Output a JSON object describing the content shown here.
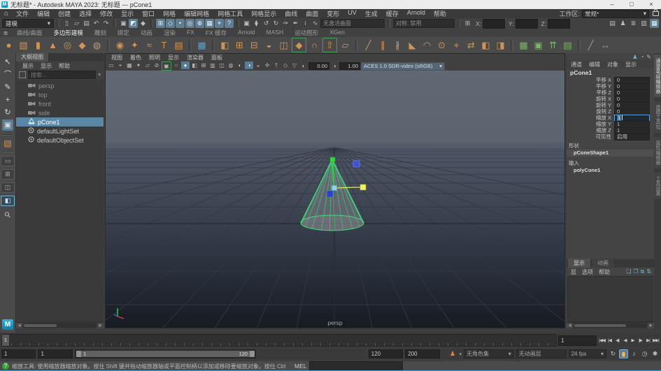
{
  "titlebar": {
    "title": "无标题* - Autodesk MAYA 2023: 无标题 --- pCone1",
    "app_badge": "M",
    "minimize": "–",
    "maximize": "□",
    "close": "×"
  },
  "menubar": {
    "home_icon": "⌂",
    "items": [
      "文件",
      "编辑",
      "创建",
      "选择",
      "修改",
      "显示",
      "窗口",
      "网格",
      "编辑网格",
      "网格工具",
      "网格显示",
      "曲线",
      "曲面",
      "变形",
      "UV",
      "生成",
      "缓存",
      "Arnold",
      "帮助"
    ],
    "workspace_label": "工作区:",
    "workspace_value": "常规*",
    "dropdown_arrow": "▾"
  },
  "statusline": {
    "mode": "建模",
    "dropdown_arrow": "▾",
    "file_icons": [
      {
        "name": "new-scene-icon",
        "glyph": "▯"
      },
      {
        "name": "open-scene-icon",
        "glyph": "▱"
      },
      {
        "name": "save-scene-icon",
        "glyph": "▤"
      },
      {
        "name": "undo-icon",
        "glyph": "↶"
      },
      {
        "name": "redo-icon",
        "glyph": "↷"
      }
    ],
    "selection_icons": [
      {
        "name": "select-hierarchy-icon",
        "glyph": "▣"
      },
      {
        "name": "select-object-icon",
        "glyph": "◩",
        "active": true
      },
      {
        "name": "select-component-icon",
        "glyph": "◆"
      }
    ],
    "snap_icons": [
      {
        "name": "snap-grid-icon",
        "glyph": "⊞"
      },
      {
        "name": "snap-curve-icon",
        "glyph": "◇"
      },
      {
        "name": "snap-point-icon",
        "glyph": "•"
      },
      {
        "name": "snap-projected-center-icon",
        "glyph": "◎"
      },
      {
        "name": "snap-view-plane-icon",
        "glyph": "⊕"
      },
      {
        "name": "make-live-icon",
        "glyph": "▦"
      },
      {
        "name": "snap-together-icon",
        "glyph": "⌖"
      },
      {
        "name": "snap-help-icon",
        "glyph": "?"
      }
    ],
    "history_icons": [
      {
        "name": "lock-selection-icon",
        "glyph": "▣"
      },
      {
        "name": "highlight-selection-icon",
        "glyph": "⧫"
      },
      {
        "name": "construction-history-icon",
        "glyph": "↺"
      },
      {
        "name": "rigid-body-icon",
        "glyph": "↻"
      },
      {
        "name": "soft-mod-icon",
        "glyph": "✑"
      },
      {
        "name": "cluster-icon",
        "glyph": "✒"
      },
      {
        "name": "curve-snap-icon",
        "glyph": "≀"
      },
      {
        "name": "wire-icon",
        "glyph": "∿"
      }
    ],
    "no_active_surface": "无激活曲面",
    "symmetry": "对称: 禁用",
    "grid_icon": "⊞",
    "axis_labels": [
      "X:",
      "Y:",
      "Z:"
    ],
    "editor_icons": [
      {
        "name": "modeling-toolkit-toggle-icon",
        "glyph": "▤"
      },
      {
        "name": "character-controls-icon",
        "glyph": "♟"
      },
      {
        "name": "attribute-editor-toggle-icon",
        "glyph": "≣"
      },
      {
        "name": "tool-settings-toggle-icon",
        "glyph": "▥"
      },
      {
        "name": "channel-box-toggle-icon",
        "glyph": "▦",
        "active": true
      }
    ]
  },
  "shelf": {
    "menu_icon": "≣",
    "tabs": [
      {
        "label": "曲线/曲面"
      },
      {
        "label": "多边形建模",
        "active": true
      },
      {
        "label": "雕刻"
      },
      {
        "label": "绑定"
      },
      {
        "label": "动画"
      },
      {
        "label": "渲染"
      },
      {
        "label": "FX"
      },
      {
        "label": "FX 缓存"
      },
      {
        "label": "Arnold"
      },
      {
        "label": "MASH"
      },
      {
        "label": "运动图形"
      },
      {
        "label": "XGen"
      }
    ],
    "icons": [
      {
        "name": "poly-sphere-icon",
        "glyph": "●",
        "color": "#d29455"
      },
      {
        "name": "poly-cube-icon",
        "glyph": "▧",
        "color": "#d29455"
      },
      {
        "name": "poly-cylinder-icon",
        "glyph": "▮",
        "color": "#d29455"
      },
      {
        "name": "poly-cone-icon",
        "glyph": "▲",
        "color": "#d29455"
      },
      {
        "name": "poly-torus-icon",
        "glyph": "◎",
        "color": "#d29455"
      },
      {
        "name": "poly-plane-icon",
        "glyph": "◆",
        "color": "#d29455"
      },
      {
        "name": "poly-disc-icon",
        "glyph": "◍",
        "color": "#d29455"
      },
      {
        "divider": true
      },
      {
        "name": "super-shape-icon",
        "glyph": "◉",
        "color": "#d29455"
      },
      {
        "name": "sweep-mesh-icon",
        "glyph": "✦",
        "color": "#d29455"
      },
      {
        "name": "curve-warp-icon",
        "glyph": "≈",
        "color": "#d29455"
      },
      {
        "name": "type-tool-icon",
        "glyph": "T",
        "color": "#d29455"
      },
      {
        "name": "svg-tool-icon",
        "glyph": "▤",
        "color": "#d29455"
      },
      {
        "divider": true
      },
      {
        "name": "modeling-toolkit-icon",
        "glyph": "▦",
        "color": "#5f9ec7"
      },
      {
        "divider": true
      },
      {
        "name": "result-mesh-icon",
        "glyph": "◧",
        "color": "#d29455"
      },
      {
        "name": "combine-icon",
        "glyph": "⊞",
        "color": "#d29455"
      },
      {
        "name": "separate-icon",
        "glyph": "⊟",
        "color": "#d29455"
      },
      {
        "name": "smooth-icon",
        "glyph": "◒",
        "color": "#d29455"
      },
      {
        "name": "subdivide-icon",
        "glyph": "◫",
        "color": "#d29455"
      },
      {
        "name": "bevel-icon",
        "glyph": "◆",
        "color": "#d29455",
        "border": "#3f9e4f"
      },
      {
        "name": "bridge-icon",
        "glyph": "∩",
        "color": "#d29455"
      },
      {
        "name": "extrude-icon",
        "glyph": "⇧",
        "color": "#d29455",
        "border": "#3f9e4f"
      },
      {
        "name": "quad-draw-icon",
        "glyph": "▱",
        "color": "#d29455"
      },
      {
        "divider": true
      },
      {
        "name": "multi-cut-icon",
        "glyph": "╱",
        "color": "#d29455"
      },
      {
        "name": "insert-edge-loop-icon",
        "glyph": "∥",
        "color": "#d29455"
      },
      {
        "name": "offset-edge-loop-icon",
        "glyph": "∦",
        "color": "#d29455"
      },
      {
        "name": "append-polygon-icon",
        "glyph": "◣",
        "color": "#d29455"
      },
      {
        "name": "sculpt-icon",
        "glyph": "◠",
        "color": "#d29455"
      },
      {
        "name": "merge-icon",
        "glyph": "⊙",
        "color": "#d29455"
      },
      {
        "name": "target-weld-icon",
        "glyph": "⌖",
        "color": "#d29455"
      },
      {
        "name": "flip-icon",
        "glyph": "⇄",
        "color": "#d29455"
      },
      {
        "name": "symmetry-icon",
        "glyph": "◧",
        "color": "#d29455"
      },
      {
        "name": "mirror-icon",
        "glyph": "◨",
        "color": "#d29455"
      },
      {
        "divider": true
      },
      {
        "name": "crease-set-icon",
        "glyph": "▦",
        "color": "#7cb46b"
      },
      {
        "name": "uv-editor-icon",
        "glyph": "▣",
        "color": "#7cb46b"
      },
      {
        "name": "normals-icon",
        "glyph": "⇈",
        "color": "#7cb46b"
      },
      {
        "name": "color-set-icon",
        "glyph": "▤",
        "color": "#7cb46b"
      },
      {
        "divider": true
      },
      {
        "name": "knife-icon",
        "glyph": "╱",
        "color": "#9a9a9a"
      },
      {
        "name": "measure-icon",
        "glyph": "↔",
        "color": "#9a9a9a"
      }
    ]
  },
  "toolbox": {
    "tools": [
      {
        "name": "select-tool",
        "glyph": "↖"
      },
      {
        "name": "lasso-tool",
        "glyph": "⌒"
      },
      {
        "name": "paint-select-tool",
        "glyph": "✎"
      },
      {
        "name": "move-tool",
        "glyph": "+"
      },
      {
        "name": "rotate-tool",
        "glyph": "↻"
      },
      {
        "name": "scale-tool",
        "glyph": "▣",
        "active": true
      }
    ],
    "symmetry_cube_glyph": "▧",
    "layouts": [
      {
        "name": "layout-single-pane",
        "glyph": "▭"
      },
      {
        "name": "layout-four-pane",
        "glyph": "⊞"
      },
      {
        "name": "layout-two-pane",
        "glyph": "◫"
      },
      {
        "name": "layout-outliner-persp",
        "glyph": "◧",
        "active": true
      }
    ],
    "magnifier_glyph": "⚲",
    "maya_logo": "M"
  },
  "outliner": {
    "title": "大纲视图",
    "menus": [
      "展示",
      "显示",
      "帮助"
    ],
    "search_placeholder": "搜索...",
    "dropdown_arrow": "▾",
    "items": [
      {
        "name": "outliner-item-persp",
        "label": "persp",
        "icon": "camera",
        "muted": true
      },
      {
        "name": "outliner-item-top",
        "label": "top",
        "icon": "camera",
        "muted": true
      },
      {
        "name": "outliner-item-front",
        "label": "front",
        "icon": "camera",
        "muted": true
      },
      {
        "name": "outliner-item-side",
        "label": "side",
        "icon": "camera",
        "muted": true
      },
      {
        "name": "outliner-item-pcone1",
        "label": "pCone1",
        "icon": "cone",
        "selected": true
      },
      {
        "name": "outliner-item-defaultlightset",
        "label": "defaultLightSet",
        "icon": "set"
      },
      {
        "name": "outliner-item-defaultobjectset",
        "label": "defaultObjectSet",
        "icon": "set"
      }
    ]
  },
  "viewport": {
    "menus": [
      "视图",
      "着色",
      "照明",
      "显示",
      "渲染器",
      "面板"
    ],
    "toolbar_icons": [
      {
        "name": "select-camera-icon",
        "glyph": "▭"
      },
      {
        "name": "lock-camera-icon",
        "glyph": "⌖"
      },
      {
        "name": "camera-attributes-icon",
        "glyph": "▦"
      },
      {
        "name": "bookmark-icon",
        "glyph": "✦"
      },
      {
        "name": "image-plane-icon",
        "glyph": "▱"
      },
      {
        "name": "2d-pan-zoom-icon",
        "glyph": "⊘"
      },
      {
        "name": "isolate-select-icon",
        "glyph": "▣",
        "border": "#3f9e4f"
      },
      {
        "name": "wireframe-icon",
        "glyph": "○"
      },
      {
        "name": "shaded-icon",
        "glyph": "●",
        "active": true
      },
      {
        "name": "textured-icon",
        "glyph": "◧"
      },
      {
        "name": "use-all-lights-icon",
        "glyph": "⊞"
      },
      {
        "name": "shadows-icon",
        "glyph": "▥"
      },
      {
        "name": "screen-space-ao-icon",
        "glyph": "◫"
      },
      {
        "name": "motion-blur-icon",
        "glyph": "◍"
      },
      {
        "name": "multisample-icon",
        "glyph": "◐"
      },
      {
        "name": "depth-of-field-icon",
        "glyph": "◑",
        "active": true
      },
      {
        "name": "xray-icon",
        "glyph": "◒"
      },
      {
        "name": "xray-joints-icon",
        "glyph": "✛"
      },
      {
        "name": "plugin-shapes-icon",
        "glyph": "†"
      },
      {
        "name": "grease-pencil-icon",
        "glyph": "◇"
      },
      {
        "name": "grid-toggle-icon",
        "glyph": "▽"
      }
    ],
    "exposure_icon": "◐",
    "exposure": "0.00",
    "gamma_icon": "◑",
    "gamma": "1.00",
    "colorspace": "ACES 1.0 SDR-video (sRGB)",
    "dropdown_arrow": "▾",
    "camera_label": "persp"
  },
  "channelbox": {
    "top_icons": [
      {
        "name": "channel-stats-icon",
        "glyph": "♟",
        "color": "#6fb3c9"
      },
      {
        "name": "channel-speed-icon",
        "glyph": "◔",
        "color": "#b8b8b8"
      },
      {
        "name": "channel-edit-icon",
        "glyph": "✎",
        "color": "#9cc98f"
      }
    ],
    "menus": [
      "通道",
      "编辑",
      "对象",
      "显示"
    ],
    "object_name": "pCone1",
    "rows": [
      {
        "label": "平移 X",
        "value": "0"
      },
      {
        "label": "平移 Y",
        "value": "0"
      },
      {
        "label": "平移 Z",
        "value": "0"
      },
      {
        "label": "旋转 X",
        "value": "0"
      },
      {
        "label": "旋转 Y",
        "value": "0"
      },
      {
        "label": "旋转 Z",
        "value": "0"
      },
      {
        "label": "缩放 X",
        "value": "1",
        "editing": true
      },
      {
        "label": "缩放 Y",
        "value": "1"
      },
      {
        "label": "缩放 Z",
        "value": "1"
      },
      {
        "label": "可见性",
        "value": "启用"
      }
    ],
    "shapes_label": "形状",
    "shape_node": "pConeShape1",
    "inputs_label": "输入",
    "input_node": "polyCone1"
  },
  "layer_editor": {
    "tabs": [
      {
        "label": "显示",
        "active": true
      },
      {
        "label": "动画"
      }
    ],
    "menus": [
      "层",
      "选项",
      "帮助"
    ],
    "icons": [
      {
        "name": "new-empty-layer-icon",
        "glyph": "❏"
      },
      {
        "name": "new-layer-selected-icon",
        "glyph": "❐"
      },
      {
        "name": "new-layer-icon",
        "glyph": "⧉"
      },
      {
        "name": "move-layer-icon",
        "glyph": "⇅"
      }
    ]
  },
  "side_tabs": [
    {
      "name": "tab-channel-box-layer-editor",
      "label": "通道盒/层编辑器",
      "active": true
    },
    {
      "name": "tab-modeling-toolkit",
      "label": "建模工具包"
    },
    {
      "name": "tab-attribute-editor",
      "label": "属性编辑器"
    },
    {
      "name": "tab-tool-settings",
      "label": "工具设置"
    }
  ],
  "timeline": {
    "marker_frame": "1",
    "current_frame": "1",
    "playback": [
      {
        "name": "go-to-start-button",
        "glyph": "|◀◀"
      },
      {
        "name": "step-back-frame-button",
        "glyph": "|◀"
      },
      {
        "name": "step-back-key-button",
        "glyph": "◀|"
      },
      {
        "name": "play-backwards-button",
        "glyph": "◀"
      },
      {
        "name": "play-forwards-button",
        "glyph": "▶"
      },
      {
        "name": "step-forward-key-button",
        "glyph": "|▶"
      },
      {
        "name": "step-forward-frame-button",
        "glyph": "▶|"
      },
      {
        "name": "go-to-end-button",
        "glyph": "▶▶|"
      }
    ]
  },
  "range": {
    "anim_start": "1",
    "playback_start": "1",
    "range_start_label": "1",
    "range_end_label": "120",
    "playback_end": "120",
    "anim_end": "200",
    "character_set": "无角色集",
    "anim_layer": "无动画层",
    "fps": "24 fps",
    "dropdown_arrow": "▾",
    "icons": [
      {
        "name": "loop-playback-icon",
        "glyph": "↻"
      },
      {
        "name": "auto-keyframe-button",
        "glyph": "⬮",
        "active": true
      },
      {
        "name": "mute-audio-icon",
        "glyph": "♪"
      },
      {
        "name": "playback-speed-icon",
        "glyph": "◷"
      },
      {
        "name": "animation-prefs-icon",
        "glyph": "✱"
      }
    ]
  },
  "helpline": {
    "badge": "?",
    "text": "缩放工具: 使用缩放器缩放对象。按住 Shift 键并拖动缩放器轴或平面控制柄以添加或移除要缩放对象。按住 Ctrl + Shift + 鼠标左键并拖动，以将缩放约束到垂直线",
    "mel_label": "MEL"
  }
}
